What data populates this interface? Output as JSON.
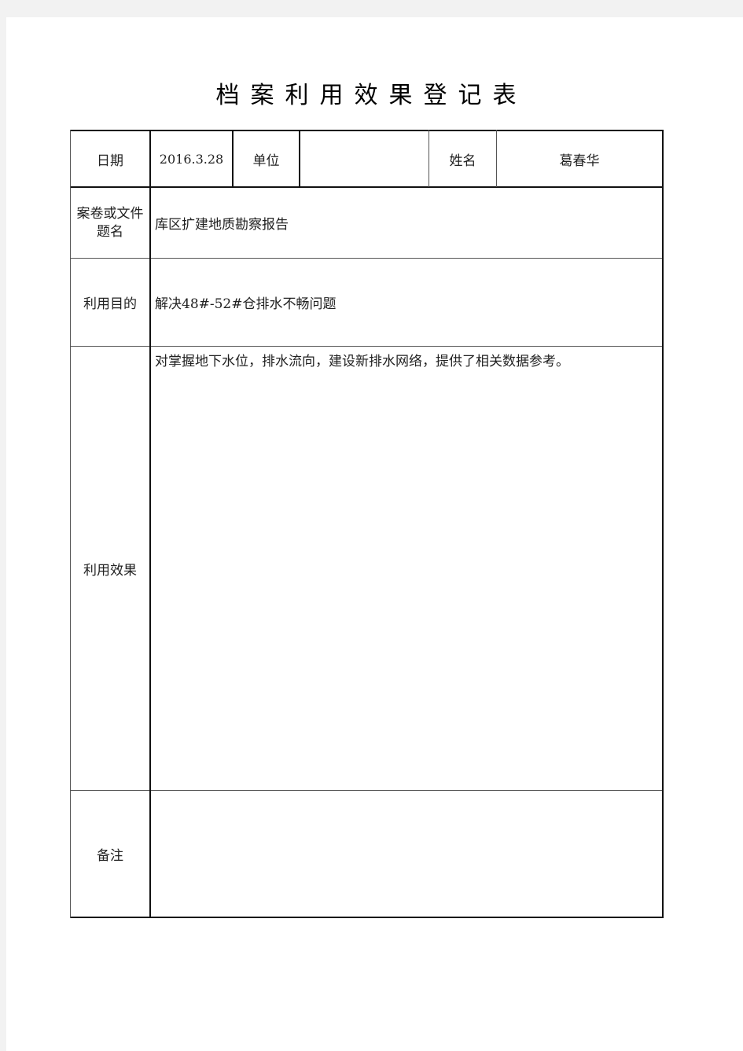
{
  "document": {
    "title": "档案利用效果登记表"
  },
  "form": {
    "row1": {
      "date_label": "日期",
      "date_value": "2016.3.28",
      "unit_label": "单位",
      "unit_value": "",
      "name_label": "姓名",
      "name_value": "葛春华"
    },
    "file_title": {
      "label_line1": "案卷或文件",
      "label_line2": "题名",
      "value": "库区扩建地质勘察报告"
    },
    "purpose": {
      "label": "利用目的",
      "value": "解决48#-52#仓排水不畅问题"
    },
    "effect": {
      "label": "利用效果",
      "value": "对掌握地下水位，排水流向，建设新排水网络，提供了相关数据参考。"
    },
    "remarks": {
      "label": "备注",
      "value": ""
    }
  }
}
